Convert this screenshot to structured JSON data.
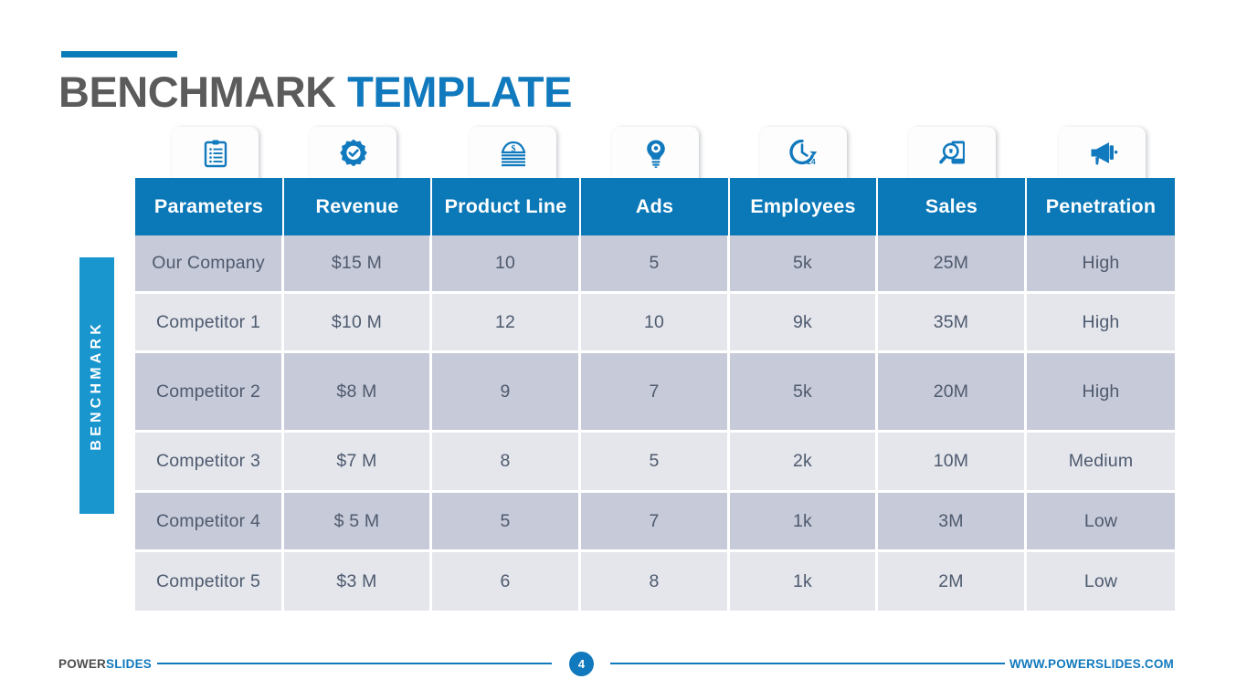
{
  "title": {
    "part1": "BENCHMARK",
    "part2": "TEMPLATE"
  },
  "side_tab": {
    "label": "BENCHMARK"
  },
  "icons": [
    {
      "name": "clipboard-icon"
    },
    {
      "name": "quality-seal-check-icon"
    },
    {
      "name": "money-stack-icon"
    },
    {
      "name": "lightbulb-idea-icon"
    },
    {
      "name": "clock-24-hours-icon"
    },
    {
      "name": "magnifier-mobile-search-icon"
    },
    {
      "name": "megaphone-icon"
    }
  ],
  "table": {
    "headers": [
      "Parameters",
      "Revenue",
      "Product Line",
      "Ads",
      "Employees",
      "Sales",
      "Penetration"
    ],
    "rows": [
      [
        "Our Company",
        "$15 M",
        "10",
        "5",
        "5k",
        "25M",
        "High"
      ],
      [
        "Competitor 1",
        "$10 M",
        "12",
        "10",
        "9k",
        "35M",
        "High"
      ],
      [
        "Competitor 2",
        "$8 M",
        "9",
        "7",
        "5k",
        "20M",
        "High"
      ],
      [
        "Competitor 3",
        "$7 M",
        "8",
        "5",
        "2k",
        "10M",
        "Medium"
      ],
      [
        "Competitor 4",
        "$ 5 M",
        "5",
        "7",
        "1k",
        "3M",
        "Low"
      ],
      [
        "Competitor 5",
        "$3 M",
        "6",
        "8",
        "1k",
        "2M",
        "Low"
      ]
    ]
  },
  "footer": {
    "brand_part1": "POWER",
    "brand_part2": "SLIDES",
    "page_number": "4",
    "website": "WWW.POWERSLIDES.COM"
  },
  "colors": {
    "header_blue": "#0b78b8",
    "accent_blue": "#1179bd",
    "tab_blue": "#1a96cf",
    "row_dark": "#c7cad8",
    "row_light": "#e4e6ec",
    "text_gray": "#4e5a6e",
    "title_gray": "#5b5b5b"
  }
}
